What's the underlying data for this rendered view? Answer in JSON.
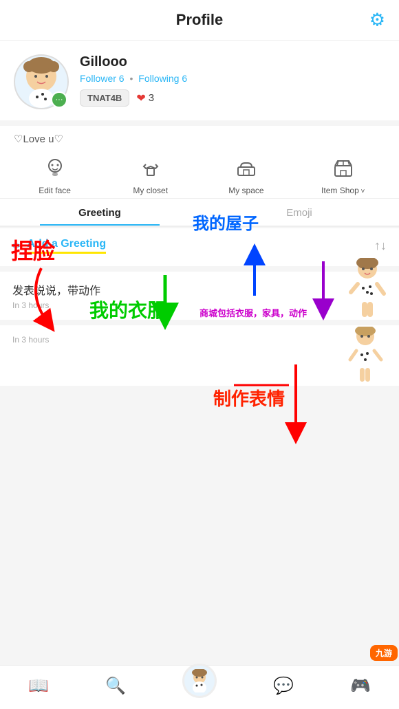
{
  "header": {
    "title": "Profile",
    "gear_icon": "⚙"
  },
  "profile": {
    "username": "Gillooo",
    "follower_label": "Follower",
    "follower_count": "6",
    "following_label": "Following",
    "following_count": "6",
    "badge_tag": "TNAT4B",
    "heart_count": "3",
    "tagline": "♡Love u♡"
  },
  "actions": [
    {
      "icon": "👤",
      "label": "Edit face"
    },
    {
      "icon": "👕",
      "label": "My closet"
    },
    {
      "icon": "🛋",
      "label": "My space"
    },
    {
      "icon": "🏪",
      "label": "Item Shop",
      "has_arrow": true
    }
  ],
  "tabs": [
    {
      "label": "Greeting",
      "active": true
    },
    {
      "label": "Emoji",
      "active": false
    }
  ],
  "greeting": {
    "add_label": "Add a Greeting",
    "pencil": "✏"
  },
  "posts": [
    {
      "content": "发表说说，带动作",
      "time": "In 3 hours"
    },
    {
      "content": "",
      "time": "In 3 hours"
    }
  ],
  "annotations": {
    "timo": "捏脸",
    "clothes": "我的衣服",
    "room": "我的屋子",
    "shop": "商城包括衣服，家具，动作",
    "emoji": "制作表情"
  },
  "bottom_nav": [
    {
      "icon": "📖",
      "label": "feed",
      "active": false
    },
    {
      "icon": "🔍",
      "label": "search",
      "active": false
    },
    {
      "icon": "avatar",
      "label": "profile",
      "active": true
    },
    {
      "icon": "💬",
      "label": "messages",
      "active": false
    },
    {
      "icon": "🎮",
      "label": "nine",
      "active": false
    }
  ]
}
